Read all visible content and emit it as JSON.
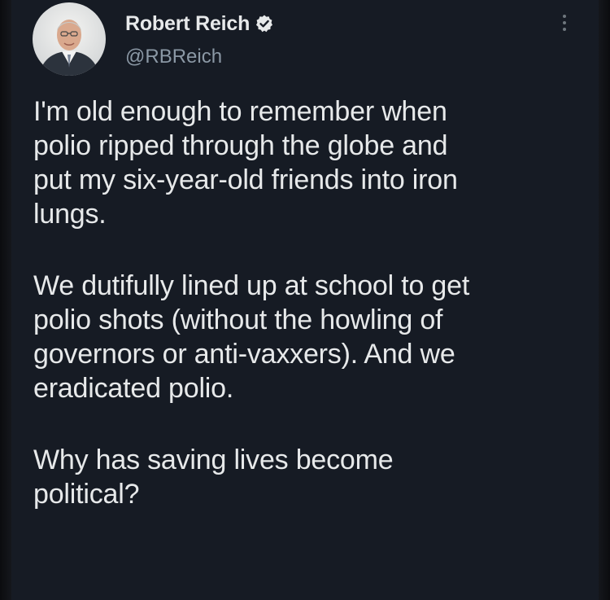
{
  "author": {
    "name": "Robert Reich",
    "handle": "@RBReich",
    "avatar_icon": "profile-photo"
  },
  "badge": {
    "icon": "verified-badge-icon"
  },
  "menu": {
    "icon": "more-options-icon"
  },
  "tweet": {
    "paragraphs": [
      [
        "I'm old enough to remember when",
        "polio ripped through the globe and",
        "put my six-year-old friends into iron",
        "lungs."
      ],
      [
        "We dutifully lined up at school to get",
        "polio shots (without the howling of",
        "governors or anti-vaxxers). And we",
        "eradicated polio."
      ],
      [
        "Why has saving lives become",
        "political?"
      ]
    ]
  },
  "colors": {
    "background": "#161b24",
    "text": "#e7e9ea",
    "secondary": "#8b98a5"
  }
}
